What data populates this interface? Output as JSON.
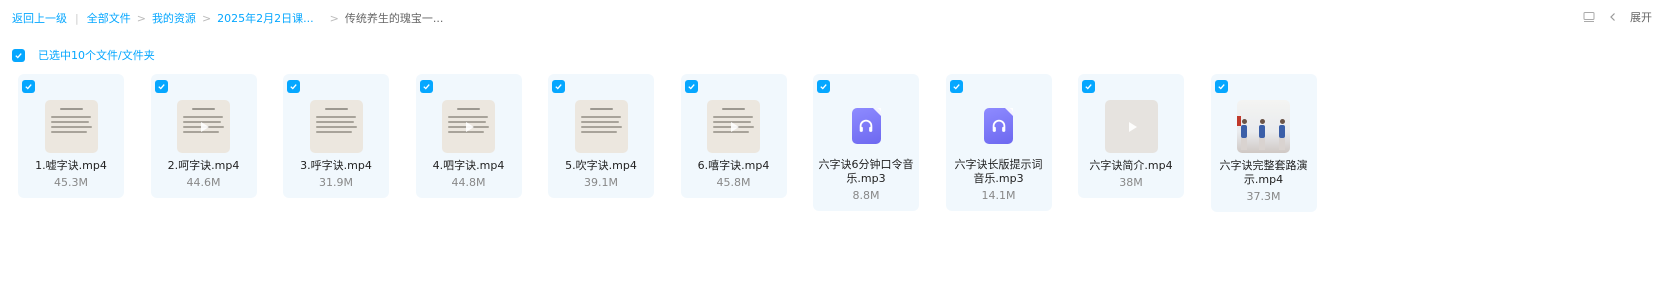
{
  "breadcrumb": {
    "back": "返回上一级",
    "items": [
      "全部文件",
      "我的资源",
      "2025年2月2日课..."
    ],
    "current": "传统养生的瑰宝一..."
  },
  "toolbar": {
    "expand_label": "展开"
  },
  "selection": {
    "label": "已选中10个文件/文件夹"
  },
  "files": [
    {
      "name": "1.嘘字诀.mp4",
      "size": "45.3M",
      "kind": "video-doc"
    },
    {
      "name": "2.呵字诀.mp4",
      "size": "44.6M",
      "kind": "video-doc"
    },
    {
      "name": "3.呼字诀.mp4",
      "size": "31.9M",
      "kind": "video-doc"
    },
    {
      "name": "4.呬字诀.mp4",
      "size": "44.8M",
      "kind": "video-doc"
    },
    {
      "name": "5.吹字诀.mp4",
      "size": "39.1M",
      "kind": "video-doc"
    },
    {
      "name": "6.嘻字诀.mp4",
      "size": "45.8M",
      "kind": "video-doc"
    },
    {
      "name": "六字诀6分钟口令音乐.mp3",
      "size": "8.8M",
      "kind": "audio"
    },
    {
      "name": "六字诀长版提示词音乐.mp3",
      "size": "14.1M",
      "kind": "audio"
    },
    {
      "name": "六字诀简介.mp4",
      "size": "38M",
      "kind": "video-blank"
    },
    {
      "name": "六字诀完整套路演示.mp4",
      "size": "37.3M",
      "kind": "video-photo"
    }
  ],
  "colors": {
    "accent": "#06a7ff",
    "card_bg": "#f1f8fd",
    "audio_icon": "#7b77f7"
  },
  "icons": {
    "checkbox": "check-icon",
    "audio": "headphones-icon",
    "play": "play-icon"
  }
}
